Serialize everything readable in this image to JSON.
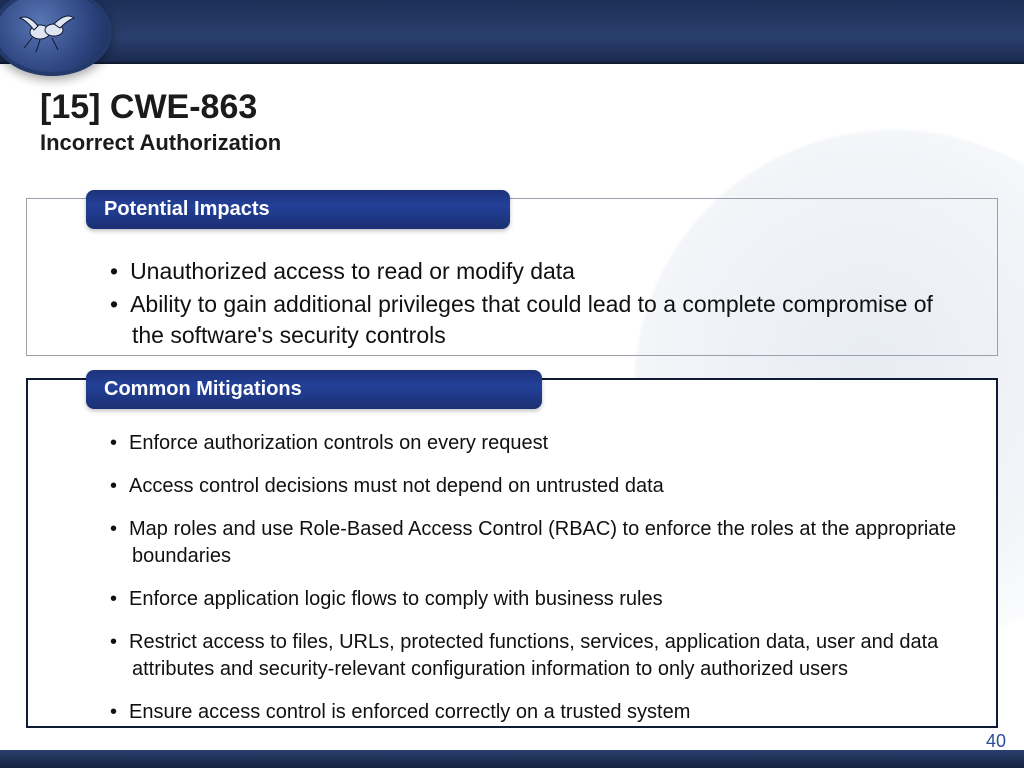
{
  "header": {
    "title": "[15] CWE-863",
    "subtitle": "Incorrect Authorization"
  },
  "impacts": {
    "label": "Potential Impacts",
    "items": [
      "Unauthorized access to read or modify data",
      "Ability to gain additional privileges that could lead to a complete compromise of the software's security controls"
    ]
  },
  "mitigations": {
    "label": "Common Mitigations",
    "items": [
      "Enforce authorization controls on every request",
      "Access control decisions must not depend on untrusted data",
      "Map roles and use Role-Based Access Control (RBAC) to enforce the roles at the appropriate boundaries",
      "Enforce application logic flows to comply with business rules",
      "Restrict access to files, URLs, protected functions, services, application data, user and data attributes and security-relevant configuration information to only authorized users",
      "Ensure access control is enforced correctly on a trusted system"
    ]
  },
  "page_number": "40"
}
